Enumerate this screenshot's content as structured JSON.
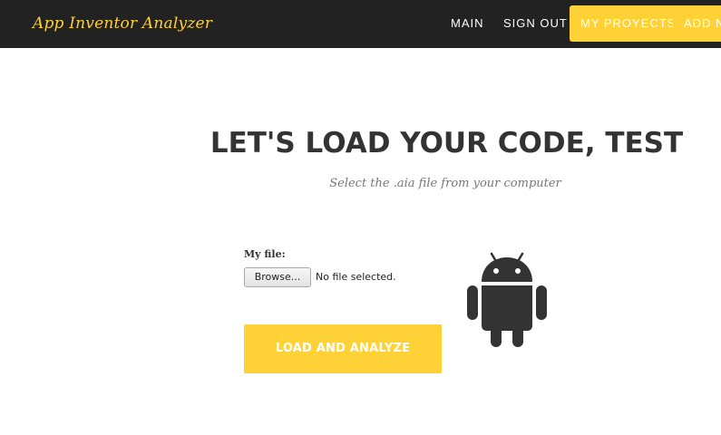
{
  "nav": {
    "brand": "App Inventor Analyzer",
    "items": [
      {
        "label": "MAIN"
      },
      {
        "label": "SIGN OUT"
      },
      {
        "label": "MY PROYECTS"
      },
      {
        "label": "ADD N"
      }
    ]
  },
  "main": {
    "title": "LET'S LOAD YOUR CODE, TEST",
    "subtitle": "Select the .aia file from your computer",
    "file_label": "My file:",
    "browse_label": "Browse...",
    "no_file_text": "No file selected.",
    "submit_label": "LOAD AND ANALYZE",
    "illustration_icon": "android-icon"
  },
  "colors": {
    "nav_bg": "#222222",
    "accent": "#fed136",
    "title": "#333333",
    "android": "#333333"
  }
}
